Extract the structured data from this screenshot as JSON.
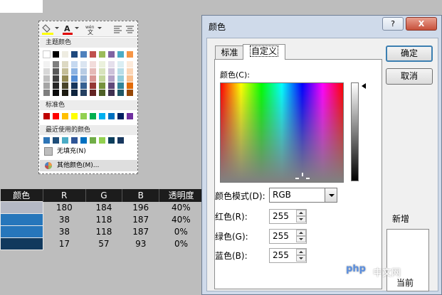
{
  "palette": {
    "theme_header": "主题颜色",
    "theme_top": [
      "#ffffff",
      "#000000",
      "#eeece1",
      "#1f497d",
      "#4f81bd",
      "#c0504d",
      "#9bbb59",
      "#8064a2",
      "#4bacc6",
      "#f79646"
    ],
    "theme_shades": [
      [
        "#f2f2f2",
        "#7f7f7f",
        "#ddd9c3",
        "#c6d9f0",
        "#dbe5f1",
        "#f2dcdb",
        "#ebf1dd",
        "#e5e0ec",
        "#dbeef3",
        "#fdeada"
      ],
      [
        "#d8d8d8",
        "#595959",
        "#c4bd97",
        "#8db3e2",
        "#b8cce4",
        "#e5b9b7",
        "#d7e3bc",
        "#ccc1d9",
        "#b7dde8",
        "#fbd5b5"
      ],
      [
        "#bfbfbf",
        "#3f3f3f",
        "#938953",
        "#548dd4",
        "#95b3d7",
        "#d99694",
        "#c3d69b",
        "#b2a2c7",
        "#92cddc",
        "#fac08f"
      ],
      [
        "#a5a5a5",
        "#262626",
        "#494429",
        "#17365d",
        "#366092",
        "#953734",
        "#76923c",
        "#5f497a",
        "#31859b",
        "#e36c09"
      ],
      [
        "#7f7f7f",
        "#0c0c0c",
        "#1d1b10",
        "#0f243e",
        "#244061",
        "#632423",
        "#4f6128",
        "#3f3151",
        "#205867",
        "#974806"
      ]
    ],
    "standard_header": "标准色",
    "standard": [
      "#c00000",
      "#ff0000",
      "#ffc000",
      "#ffff00",
      "#92d050",
      "#00b050",
      "#00b0f0",
      "#0070c0",
      "#002060",
      "#7030a0"
    ],
    "recent_header": "最近使用的颜色",
    "recent": [
      "#2e75b6",
      "#1f4e79",
      "#4bacc6",
      "#2f5597",
      "#0070c0",
      "#70ad47",
      "#92d050",
      "#0b3d5c",
      "#17375e"
    ],
    "no_fill": "无填充(N)",
    "more_colors": "其他颜色(M)..."
  },
  "table": {
    "headers": [
      "颜色",
      "R",
      "G",
      "B",
      "透明度"
    ],
    "rows": [
      {
        "color": "#b4b8c4",
        "r": "180",
        "g": "184",
        "b": "196",
        "alpha": "40%"
      },
      {
        "color": "#2676bb",
        "r": "38",
        "g": "118",
        "b": "187",
        "alpha": "40%"
      },
      {
        "color": "#2676bb",
        "r": "38",
        "g": "118",
        "b": "187",
        "alpha": "0%"
      },
      {
        "color": "#11395d",
        "r": "17",
        "g": "57",
        "b": "93",
        "alpha": "0%"
      }
    ]
  },
  "dialog": {
    "title": "颜色",
    "help": "?",
    "close": "X",
    "tabs": [
      "标准",
      "自定义"
    ],
    "colors_label": "颜色(C):",
    "model_label": "颜色模式(D):",
    "model_value": "RGB",
    "red_label": "红色(R):",
    "green_label": "绿色(G):",
    "blue_label": "蓝色(B):",
    "red": "255",
    "green": "255",
    "blue": "255",
    "ok": "确定",
    "cancel": "取消",
    "new_label": "新增",
    "current_label": "当前"
  },
  "watermark": {
    "logo": "php",
    "text": "中文网"
  }
}
